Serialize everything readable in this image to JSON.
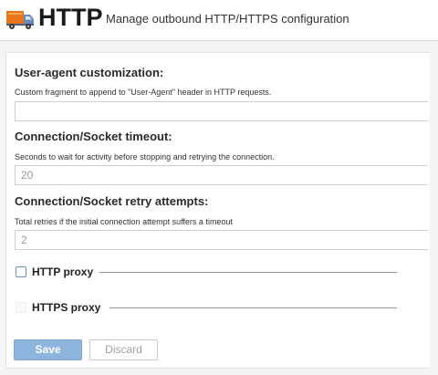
{
  "header": {
    "icon": "truck-icon",
    "title": "HTTP",
    "subtitle": "Manage outbound HTTP/HTTPS configuration"
  },
  "user_agent": {
    "title": "User-agent customization:",
    "help": "Custom fragment to append to \"User-Agent\" header in HTTP requests.",
    "value": "",
    "placeholder": ""
  },
  "timeout": {
    "title": "Connection/Socket timeout:",
    "help": "Seconds to wait for activity before stopping and retrying the connection.",
    "value": "20"
  },
  "retry": {
    "title": "Connection/Socket retry attempts:",
    "help": "Total retries if the initial connection attempt suffers a timeout",
    "value": "2"
  },
  "http_proxy": {
    "label": "HTTP proxy",
    "checked": false
  },
  "https_proxy": {
    "label": "HTTPS proxy",
    "checked": false,
    "disabled": true
  },
  "buttons": {
    "save_label": "Save",
    "discard_label": "Discard"
  },
  "colors": {
    "truck_body": "#e8751a",
    "truck_cab": "#6d8bb8",
    "save_button": "#8eb5dd"
  }
}
